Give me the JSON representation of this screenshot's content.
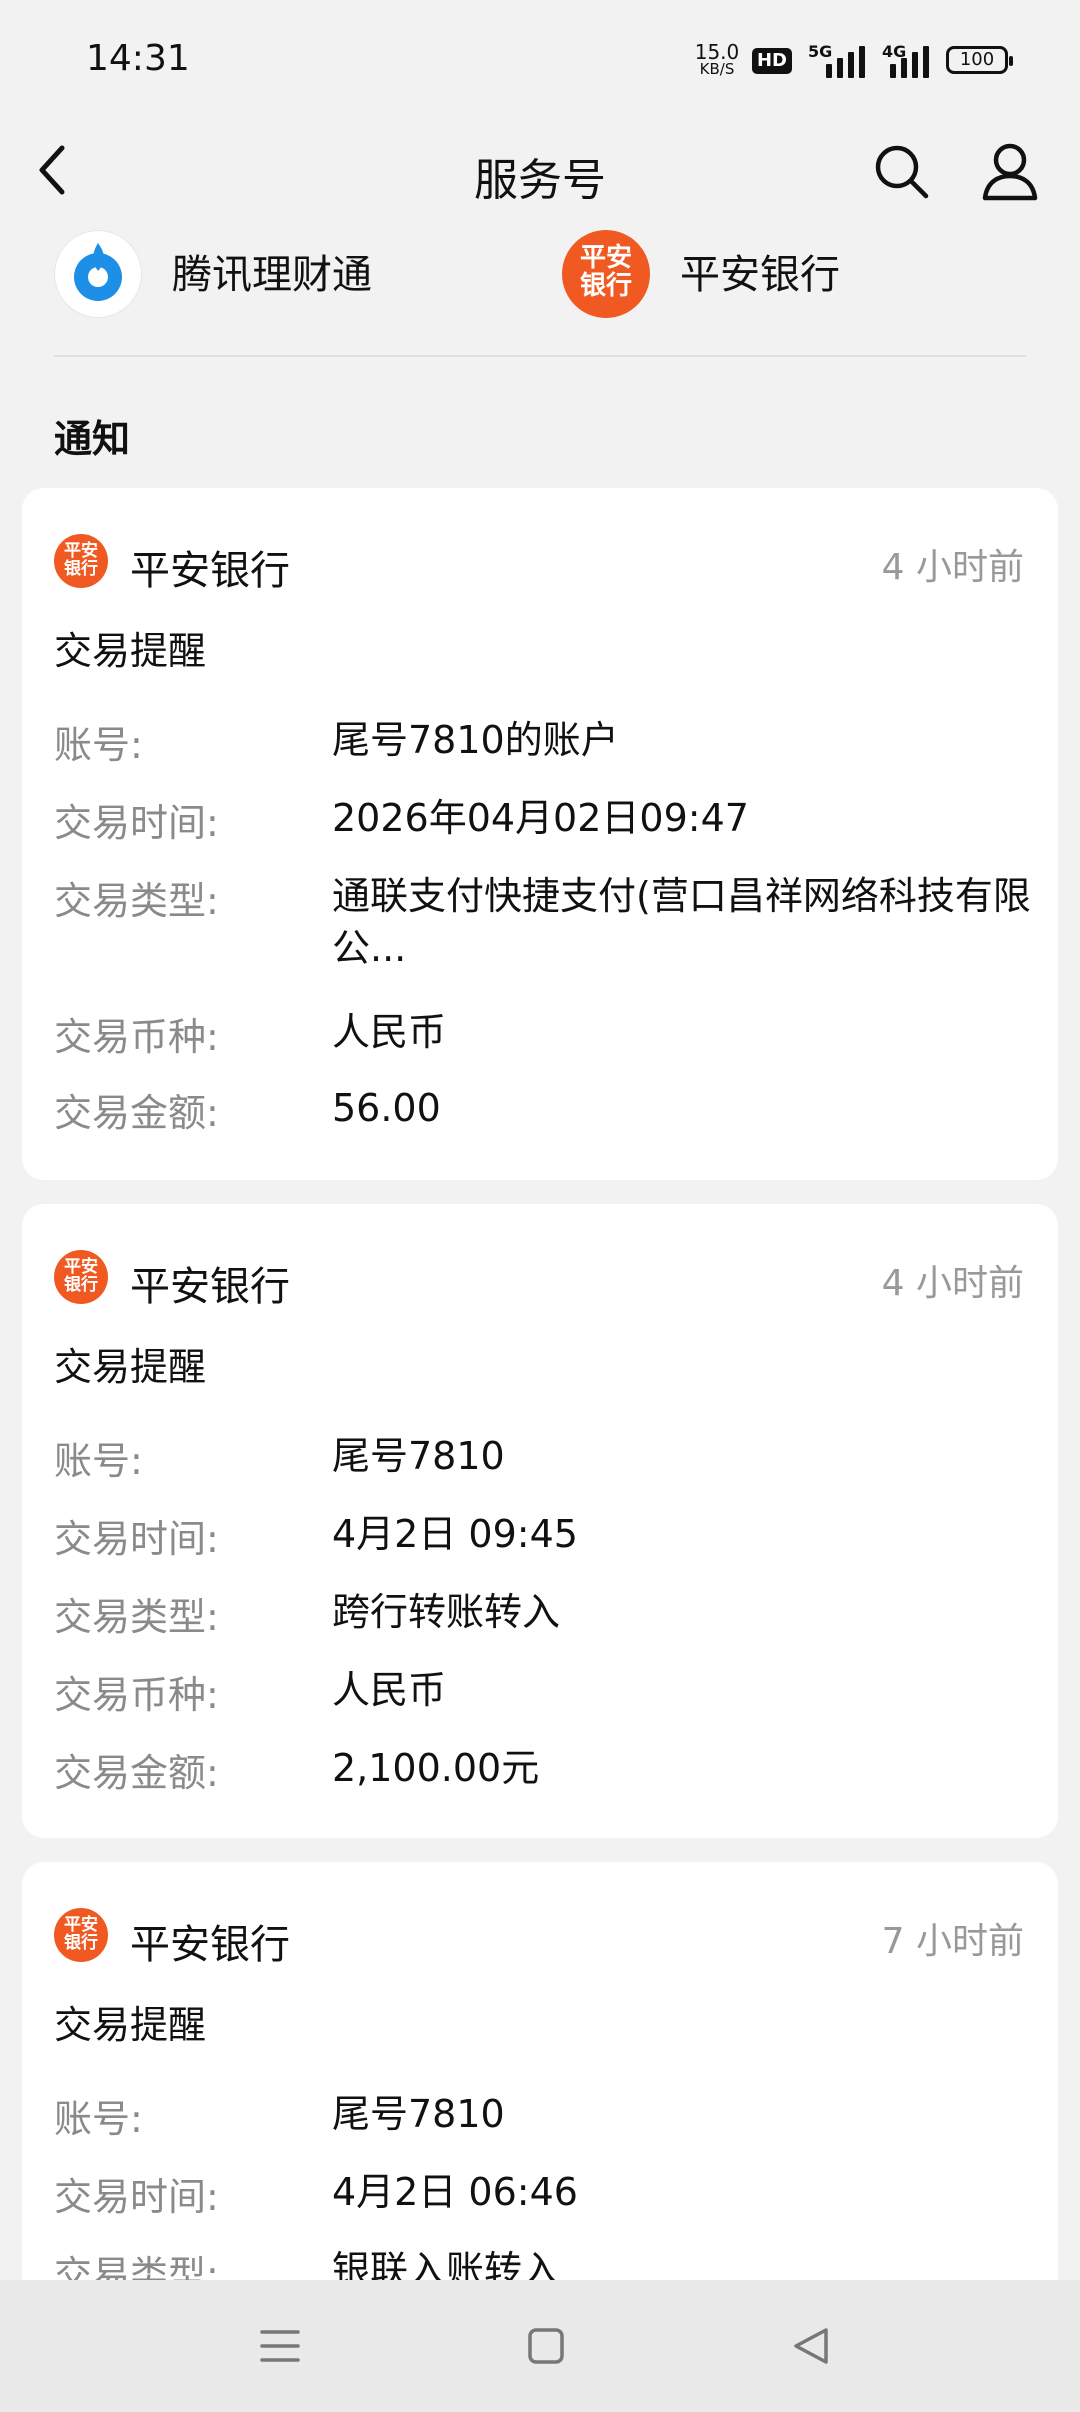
{
  "status_bar": {
    "time": "14:31",
    "net_speed": "15.0",
    "net_unit": "KB/S",
    "hd": "HD",
    "sim1": "5G",
    "sim2": "4G",
    "battery": "100"
  },
  "header": {
    "title": "服务号",
    "icons": [
      "back-icon",
      "search-icon",
      "profile-icon"
    ]
  },
  "accounts": [
    {
      "name": "腾讯理财通",
      "icon": "tencent-licaitong-logo"
    },
    {
      "name": "平安银行",
      "icon": "pingan-bank-logo",
      "logo_text_top": "平安",
      "logo_text_bottom": "银行"
    }
  ],
  "section_title": "通知",
  "logo_text": {
    "top": "平安",
    "bottom": "银行",
    "color": "#f05a22"
  },
  "cards": [
    {
      "bank": "平安银行",
      "time_ago": "4 小时前",
      "subject": "交易提醒",
      "rows": [
        {
          "k": "账号:",
          "v": "尾号7810的账户"
        },
        {
          "k": "交易时间:",
          "v": "2026年04月02日09:47"
        },
        {
          "k": "交易类型:",
          "v": "通联支付快捷支付(营口昌祥网络科技有限公..."
        },
        {
          "k": "交易币种:",
          "v": "人民币"
        },
        {
          "k": "交易金额:",
          "v": "56.00"
        }
      ]
    },
    {
      "bank": "平安银行",
      "time_ago": "4 小时前",
      "subject": "交易提醒",
      "rows": [
        {
          "k": "账号:",
          "v": "尾号7810"
        },
        {
          "k": "交易时间:",
          "v": "4月2日 09:45"
        },
        {
          "k": "交易类型:",
          "v": "跨行转账转入"
        },
        {
          "k": "交易币种:",
          "v": "人民币"
        },
        {
          "k": "交易金额:",
          "v": "2,100.00元"
        }
      ]
    },
    {
      "bank": "平安银行",
      "time_ago": "7 小时前",
      "subject": "交易提醒",
      "rows": [
        {
          "k": "账号:",
          "v": "尾号7810"
        },
        {
          "k": "交易时间:",
          "v": "4月2日 06:46"
        },
        {
          "k": "交易类型:",
          "v": "银联入账转入"
        }
      ]
    }
  ],
  "nav_bar": {
    "icons": [
      "menu-icon",
      "home-icon",
      "back-triangle-icon"
    ]
  }
}
